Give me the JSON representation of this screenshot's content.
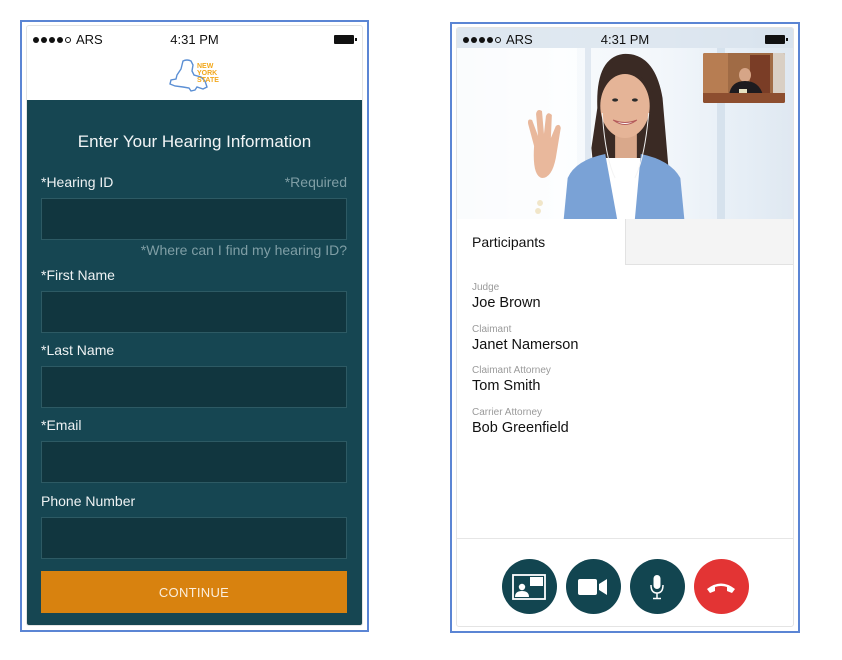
{
  "left_screen": {
    "status_bar": {
      "carrier": "ARS",
      "signal_bars_filled": 4,
      "signal_bars_total": 5,
      "time": "4:31 PM"
    },
    "logo": {
      "name": "new-york-state-logo",
      "lines": [
        "NEW",
        "YORK",
        "STATE"
      ]
    },
    "form": {
      "title": "Enter Your Hearing Information",
      "required_note": "*Required",
      "fields": [
        {
          "label": "*Hearing ID",
          "value": "",
          "placeholder": ""
        },
        {
          "label": "*First Name",
          "value": "",
          "placeholder": ""
        },
        {
          "label": "*Last Name",
          "value": "",
          "placeholder": ""
        },
        {
          "label": "*Email",
          "value": "",
          "placeholder": ""
        },
        {
          "label": "Phone Number",
          "value": "",
          "placeholder": ""
        }
      ],
      "help_link": "*Where can I find my hearing ID?",
      "continue_label": "CONTINUE"
    },
    "colors": {
      "panel": "#164652",
      "input": "#11363f",
      "button": "#d8820f",
      "muted_text": "#7f9ea5"
    }
  },
  "right_screen": {
    "status_bar": {
      "carrier": "ARS",
      "signal_bars_filled": 4,
      "signal_bars_total": 5,
      "time": "4:31 PM"
    },
    "tabs": [
      {
        "label": "Participants",
        "active": true
      },
      {
        "label": "",
        "active": false
      }
    ],
    "participants": [
      {
        "role": "Judge",
        "name": "Joe Brown"
      },
      {
        "role": "Claimant",
        "name": "Janet Namerson"
      },
      {
        "role": "Claimant Attorney",
        "name": "Tom Smith"
      },
      {
        "role": "Carrier Attorney",
        "name": "Bob Greenfield"
      }
    ],
    "controls": [
      {
        "name": "share-screen",
        "icon": "contact-card-icon"
      },
      {
        "name": "camera",
        "icon": "video-camera-icon"
      },
      {
        "name": "microphone",
        "icon": "microphone-icon"
      },
      {
        "name": "end-call",
        "icon": "hang-up-icon"
      }
    ],
    "colors": {
      "control": "#124550",
      "end_call": "#e33434"
    }
  }
}
